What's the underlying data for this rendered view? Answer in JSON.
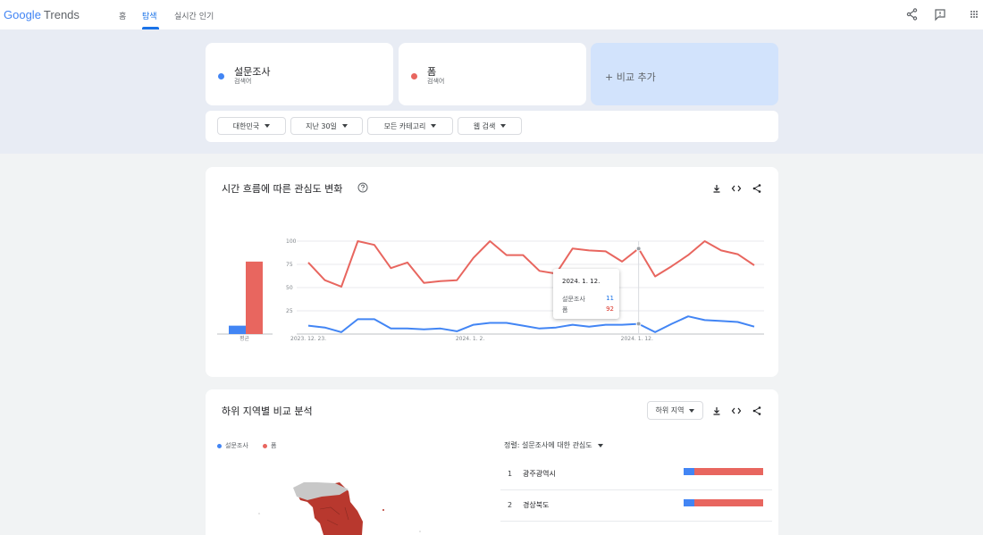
{
  "header": {
    "logo_google": "Google",
    "logo_trends": "Trends",
    "tabs": [
      {
        "label": "홈",
        "active": false
      },
      {
        "label": "탐색",
        "active": true
      },
      {
        "label": "실시간 인기",
        "active": false
      }
    ],
    "icons": [
      "share-icon",
      "feedback-icon",
      "apps-icon"
    ]
  },
  "terms": [
    {
      "name": "설문조사",
      "sub": "검색어",
      "color": "#4285f4"
    },
    {
      "name": "폼",
      "sub": "검색어",
      "color": "#e8665f"
    }
  ],
  "add_compare": "+ 비교 추가",
  "filters": [
    {
      "label": "대한민국"
    },
    {
      "label": "지난 30일"
    },
    {
      "label": "모든 카테고리"
    },
    {
      "label": "웹 검색"
    }
  ],
  "interest_panel": {
    "title": "시간 흐름에 따른 관심도 변화",
    "avg_label": "평균",
    "tooltip": {
      "date": "2024. 1. 12.",
      "rows": [
        {
          "term": "설문조사",
          "value": "11",
          "color": "#1a73e8"
        },
        {
          "term": "폼",
          "value": "92",
          "color": "#d93025"
        }
      ]
    }
  },
  "chart_data": {
    "type": "line",
    "x": [
      "2023. 12. 23.",
      "2023. 12. 24.",
      "2023. 12. 25.",
      "2023. 12. 26.",
      "2023. 12. 27.",
      "2023. 12. 28.",
      "2023. 12. 29.",
      "2023. 12. 30.",
      "2023. 12. 31.",
      "2024. 1. 1.",
      "2024. 1. 2.",
      "2024. 1. 3.",
      "2024. 1. 4.",
      "2024. 1. 5.",
      "2024. 1. 6.",
      "2024. 1. 7.",
      "2024. 1. 8.",
      "2024. 1. 9.",
      "2024. 1. 10.",
      "2024. 1. 11.",
      "2024. 1. 12.",
      "2024. 1. 13.",
      "2024. 1. 14.",
      "2024. 1. 15.",
      "2024. 1. 16.",
      "2024. 1. 17.",
      "2024. 1. 18.",
      "2024. 1. 19."
    ],
    "xticks": [
      "2023. 12. 23.",
      "2024. 1. 2.",
      "2024. 1. 12."
    ],
    "yticks": [
      25,
      50,
      75,
      100
    ],
    "ylim": [
      0,
      100
    ],
    "series": [
      {
        "name": "설문조사",
        "color": "#4285f4",
        "average": 9,
        "values": [
          9,
          7,
          2,
          16,
          16,
          6,
          6,
          5,
          6,
          3,
          10,
          12,
          12,
          9,
          6,
          7,
          10,
          8,
          10,
          10,
          11,
          2,
          11,
          19,
          15,
          14,
          13,
          8
        ]
      },
      {
        "name": "폼",
        "color": "#e8665f",
        "average": 78,
        "values": [
          77,
          58,
          51,
          100,
          96,
          71,
          77,
          55,
          57,
          58,
          82,
          100,
          85,
          85,
          68,
          65,
          92,
          90,
          89,
          78,
          92,
          62,
          73,
          85,
          100,
          90,
          86,
          74
        ]
      }
    ]
  },
  "region_panel": {
    "title": "하위 지역별 비교 분석",
    "region_select": "하위 지역",
    "legend": [
      {
        "label": "설문조사",
        "color": "#4285f4"
      },
      {
        "label": "폼",
        "color": "#e8665f"
      }
    ],
    "sort_label": "정렬: 설문조사에 대한 관심도",
    "rows": [
      {
        "rank": "1",
        "name": "광주광역시",
        "share_a": 0.14,
        "share_b": 0.86
      },
      {
        "rank": "2",
        "name": "경상북도",
        "share_a": 0.14,
        "share_b": 0.86
      }
    ]
  }
}
